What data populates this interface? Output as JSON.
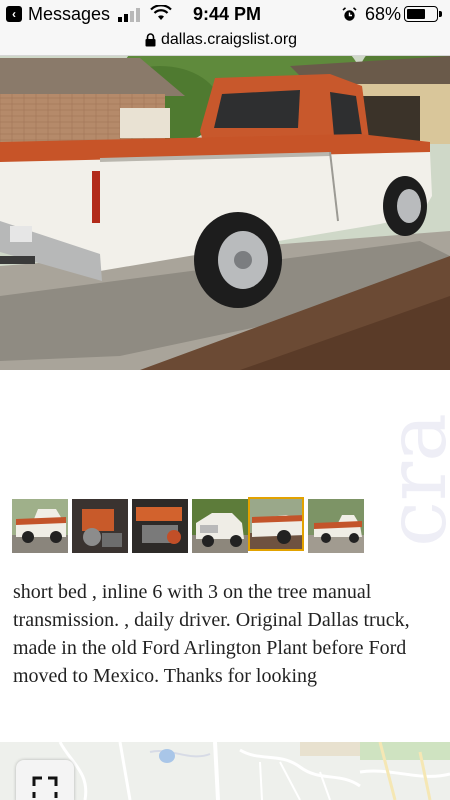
{
  "status_bar": {
    "back_app": "Messages",
    "time": "9:44 PM",
    "battery_percent": "68%",
    "battery_level": 0.68,
    "icons": [
      "back-arrow-icon",
      "cellular-signal-icon",
      "wifi-icon",
      "alarm-icon",
      "battery-icon"
    ]
  },
  "browser": {
    "url": "dallas.craigslist.org",
    "lock_icon": "lock-icon"
  },
  "gallery": {
    "thumbnails": [
      {
        "subject": "truck-side"
      },
      {
        "subject": "engine-bay"
      },
      {
        "subject": "engine-closeup"
      },
      {
        "subject": "truck-front"
      },
      {
        "subject": "truck-rear",
        "selected": true
      },
      {
        "subject": "truck-side-far"
      }
    ],
    "selected_index": 4,
    "accent_color": "#e2a200"
  },
  "listing": {
    "description": "short bed , inline 6 with 3 on the tree manual transmission. , daily driver. Original Dallas truck, made in the old Ford Arlington Plant before Ford moved to Mexico. Thanks for looking"
  },
  "map": {
    "expand_icon": "expand-icon"
  },
  "watermark": {
    "text": "cra"
  }
}
